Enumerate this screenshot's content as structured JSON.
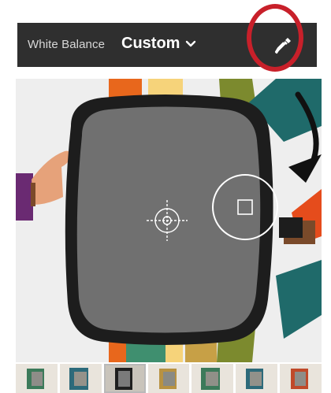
{
  "toolbar": {
    "label": "White Balance",
    "value": "Custom",
    "chevron_icon": "chevron-down-icon",
    "picker_icon": "eyedropper-icon"
  },
  "colors": {
    "toolbar_bg": "#2f2f2f",
    "callout_ring": "#c8202a",
    "gray_card": "#707070"
  },
  "filmstrip": {
    "thumbnails": 7,
    "selected_index": 2
  }
}
